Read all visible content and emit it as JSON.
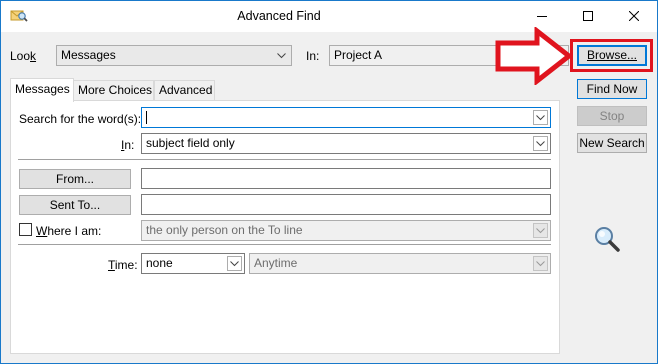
{
  "window": {
    "title": "Advanced Find",
    "minimize_icon": "minimize-icon",
    "maximize_icon": "maximize-icon",
    "close_icon": "close-icon",
    "app_icon": "advanced-find-icon"
  },
  "look": {
    "label_prefix": "Loo",
    "label_key": "k",
    "value": "Messages",
    "in_label": "In:",
    "in_value": "Project A",
    "browse_label": "Browse..."
  },
  "tabs": [
    {
      "label": "Messages"
    },
    {
      "label": "More Choices"
    },
    {
      "label": "Advanced"
    }
  ],
  "form": {
    "search_label_prefix": "Search for the word(s):",
    "search_value": "",
    "in_label_key": "I",
    "in_label_rest": "n:",
    "in_value": "subject field only",
    "from_label": "From...",
    "from_value": "",
    "sent_to_label": "Sent To...",
    "sent_to_value": "",
    "where_label_key": "W",
    "where_label_rest": "here I am:",
    "where_value": "the only person on the To line",
    "time_label_key": "T",
    "time_label_rest": "ime:",
    "time_value": "none",
    "time_range_value": "Anytime"
  },
  "actions": {
    "find_now": "Find Now",
    "stop": "Stop",
    "new_search": "New Search",
    "search_icon": "magnifier-icon"
  },
  "annotation": {
    "arrow_color": "#e0141e",
    "highlight_color": "#e0141e"
  }
}
